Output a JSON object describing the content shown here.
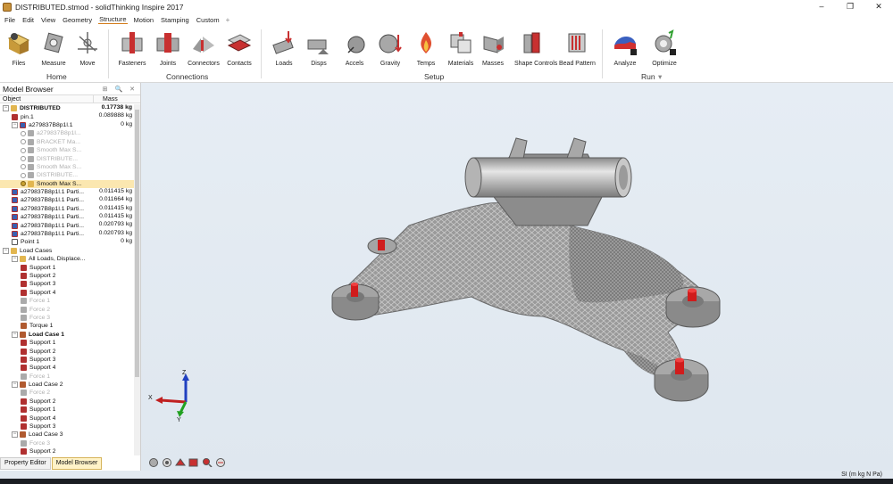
{
  "title": "DISTRIBUTED.stmod - solidThinking Inspire 2017",
  "window_controls": [
    "–",
    "❐",
    "✕"
  ],
  "menu": {
    "items": [
      "File",
      "Edit",
      "View",
      "Geometry",
      "Structure",
      "Motion",
      "Stamping",
      "Custom"
    ],
    "active": "Structure",
    "add": "+"
  },
  "ribbon": {
    "buttons": [
      "Files",
      "Measure",
      "Move",
      "Fasteners",
      "Joints",
      "Connectors",
      "Contacts",
      "Loads",
      "Disps",
      "Accels",
      "Gravity",
      "Temps",
      "Materials",
      "Masses",
      "Shape Controls",
      "Bead Pattern",
      "Analyze",
      "Optimize"
    ],
    "groups": [
      "Home",
      "Connections",
      "Setup",
      "Run"
    ],
    "run_arrow": "▾"
  },
  "model_browser": {
    "title": "Model Browser",
    "controls": "⊞ 🔍 ✕",
    "col_object": "Object",
    "col_mass": "Mass",
    "rows": [
      {
        "name": "DISTRIBUTED",
        "mass": "0.17738 kg"
      },
      {
        "name": "pin.1",
        "mass": "0.089888 kg"
      },
      {
        "name": "a279837B8p1l.1",
        "mass": "0 kg"
      },
      {
        "name": "a279837B8p1l...",
        "mass": ""
      },
      {
        "name": "BRACKET Ma...",
        "mass": ""
      },
      {
        "name": "Smooth Max S...",
        "mass": ""
      },
      {
        "name": "DISTRIBUTE...",
        "mass": ""
      },
      {
        "name": "Smooth Max S...",
        "mass": ""
      },
      {
        "name": "DISTRIBUTE...",
        "mass": ""
      },
      {
        "name": "Smooth Max S...",
        "mass": ""
      },
      {
        "name": "a279837B8p1l.1 Parti...",
        "mass": "0.011415 kg"
      },
      {
        "name": "a279837B8p1l.1 Parti...",
        "mass": "0.011664 kg"
      },
      {
        "name": "a279837B8p1l.1 Parti...",
        "mass": "0.011415 kg"
      },
      {
        "name": "a279837B8p1l.1 Parti...",
        "mass": "0.011415 kg"
      },
      {
        "name": "a279837B8p1l.1 Parti...",
        "mass": "0.020793 kg"
      },
      {
        "name": "a279837B8p1l.1 Parti...",
        "mass": "0.020793 kg"
      },
      {
        "name": "Point 1",
        "mass": "0 kg"
      },
      {
        "name": "Load Cases",
        "mass": ""
      },
      {
        "name": "All Loads, Displace...",
        "mass": ""
      },
      {
        "name": "Support 1",
        "mass": ""
      },
      {
        "name": "Support 2",
        "mass": ""
      },
      {
        "name": "Support 3",
        "mass": ""
      },
      {
        "name": "Support 4",
        "mass": ""
      },
      {
        "name": "Force 1",
        "mass": ""
      },
      {
        "name": "Force 2",
        "mass": ""
      },
      {
        "name": "Force 3",
        "mass": ""
      },
      {
        "name": "Torque 1",
        "mass": ""
      },
      {
        "name": "Load Case 1",
        "mass": ""
      },
      {
        "name": "Support 1",
        "mass": ""
      },
      {
        "name": "Support 2",
        "mass": ""
      },
      {
        "name": "Support 3",
        "mass": ""
      },
      {
        "name": "Support 4",
        "mass": ""
      },
      {
        "name": "Force 1",
        "mass": ""
      },
      {
        "name": "Load Case 2",
        "mass": ""
      },
      {
        "name": "Force 2",
        "mass": ""
      },
      {
        "name": "Support 2",
        "mass": ""
      },
      {
        "name": "Support 1",
        "mass": ""
      },
      {
        "name": "Support 4",
        "mass": ""
      },
      {
        "name": "Support 3",
        "mass": ""
      },
      {
        "name": "Load Case 3",
        "mass": ""
      },
      {
        "name": "Force 3",
        "mass": ""
      },
      {
        "name": "Support 2",
        "mass": ""
      }
    ]
  },
  "bottom_tabs": [
    "Property Editor",
    "Model Browser"
  ],
  "axes": {
    "x": "X",
    "y": "Y",
    "z": "Z"
  },
  "status": {
    "units": "SI (m kg N Pa)"
  },
  "colors": {
    "accent": "#d27a18",
    "viewport": "#e2e9f0",
    "part": "#8c8c8c",
    "support": "#d01c1c"
  }
}
